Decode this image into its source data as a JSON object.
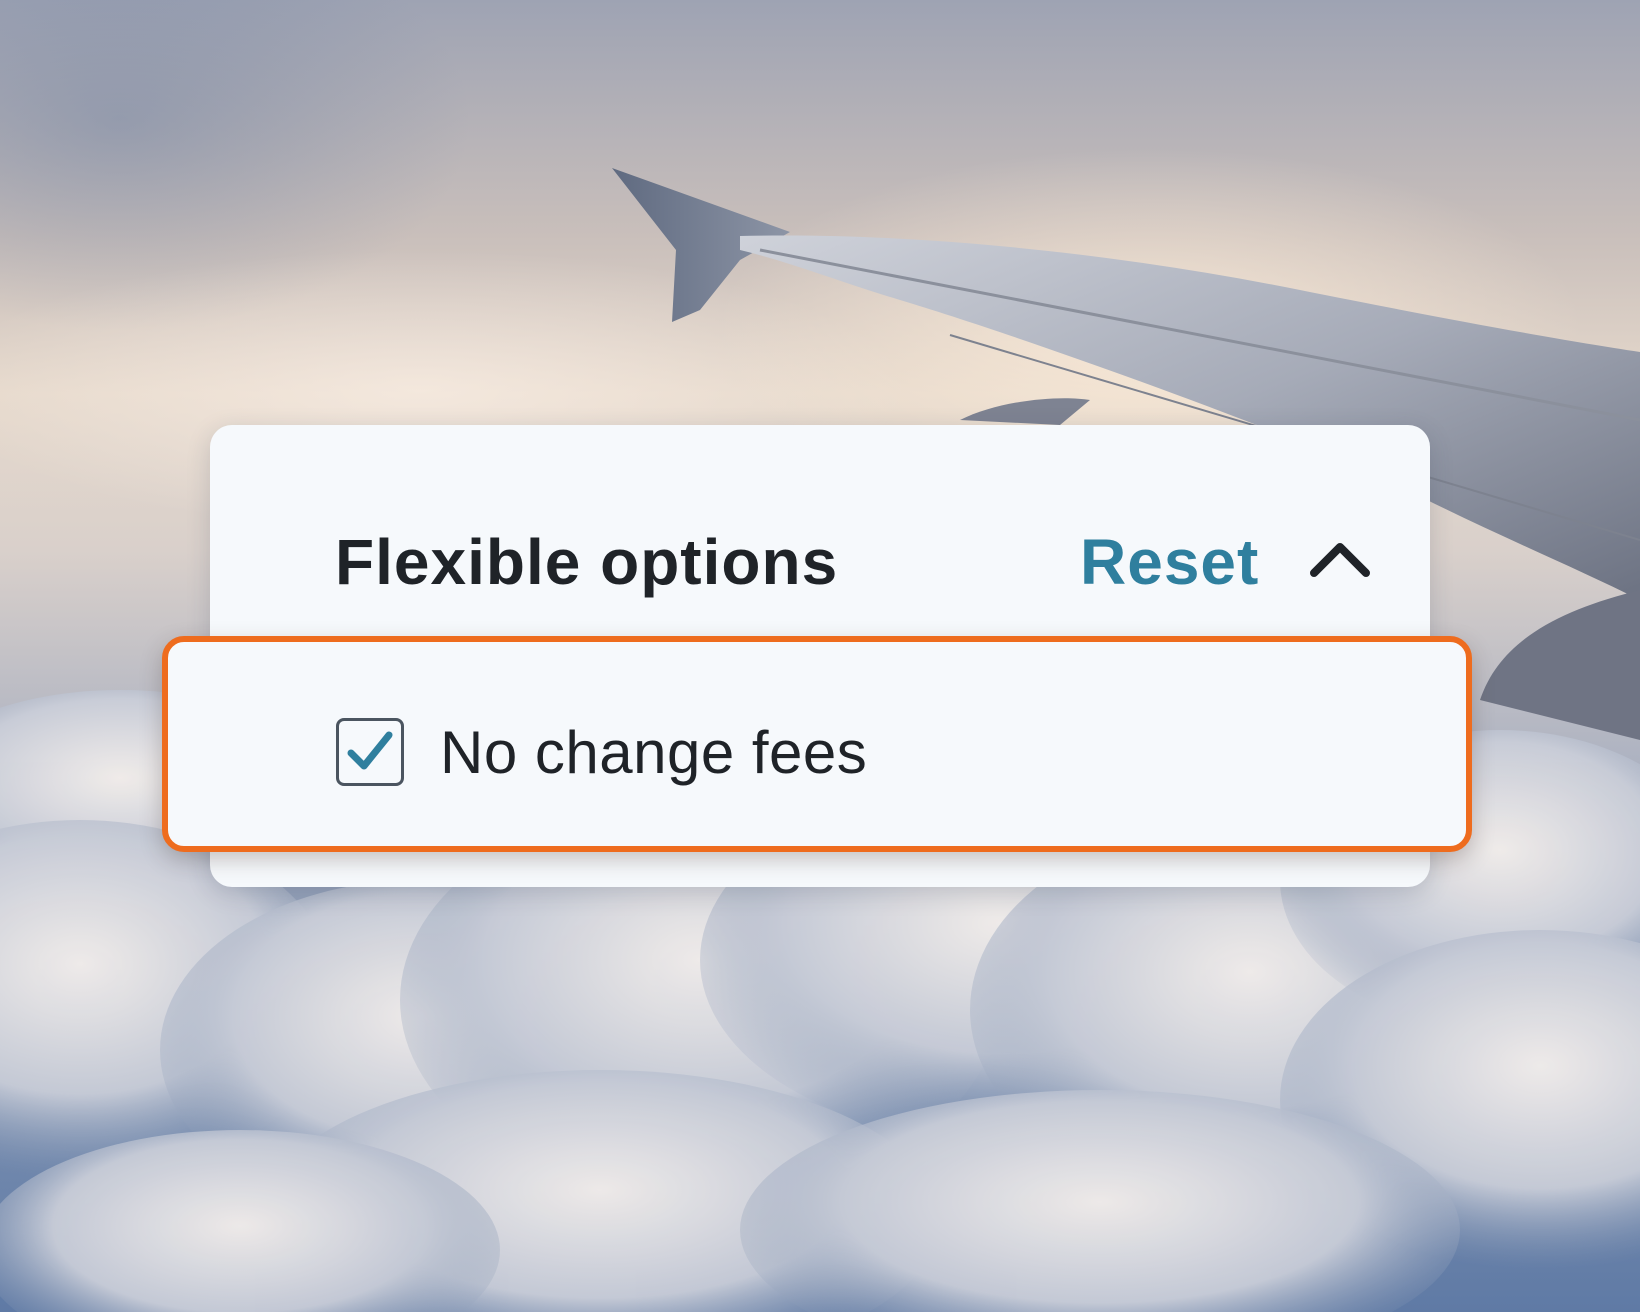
{
  "background": {
    "scene": "airplane-wing-above-clouds"
  },
  "filter_panel": {
    "title": "Flexible options",
    "reset_label": "Reset",
    "collapse_icon": "chevron-up-icon",
    "options": [
      {
        "label": "No change fees",
        "checked": true,
        "icon": "check-icon"
      }
    ]
  },
  "colors": {
    "accent_link": "#2f7f9e",
    "highlight_border": "#ee6c1e",
    "checkmark": "#2f7f9e",
    "panel_bg": "#f6f9fc",
    "text": "#1f2328"
  }
}
